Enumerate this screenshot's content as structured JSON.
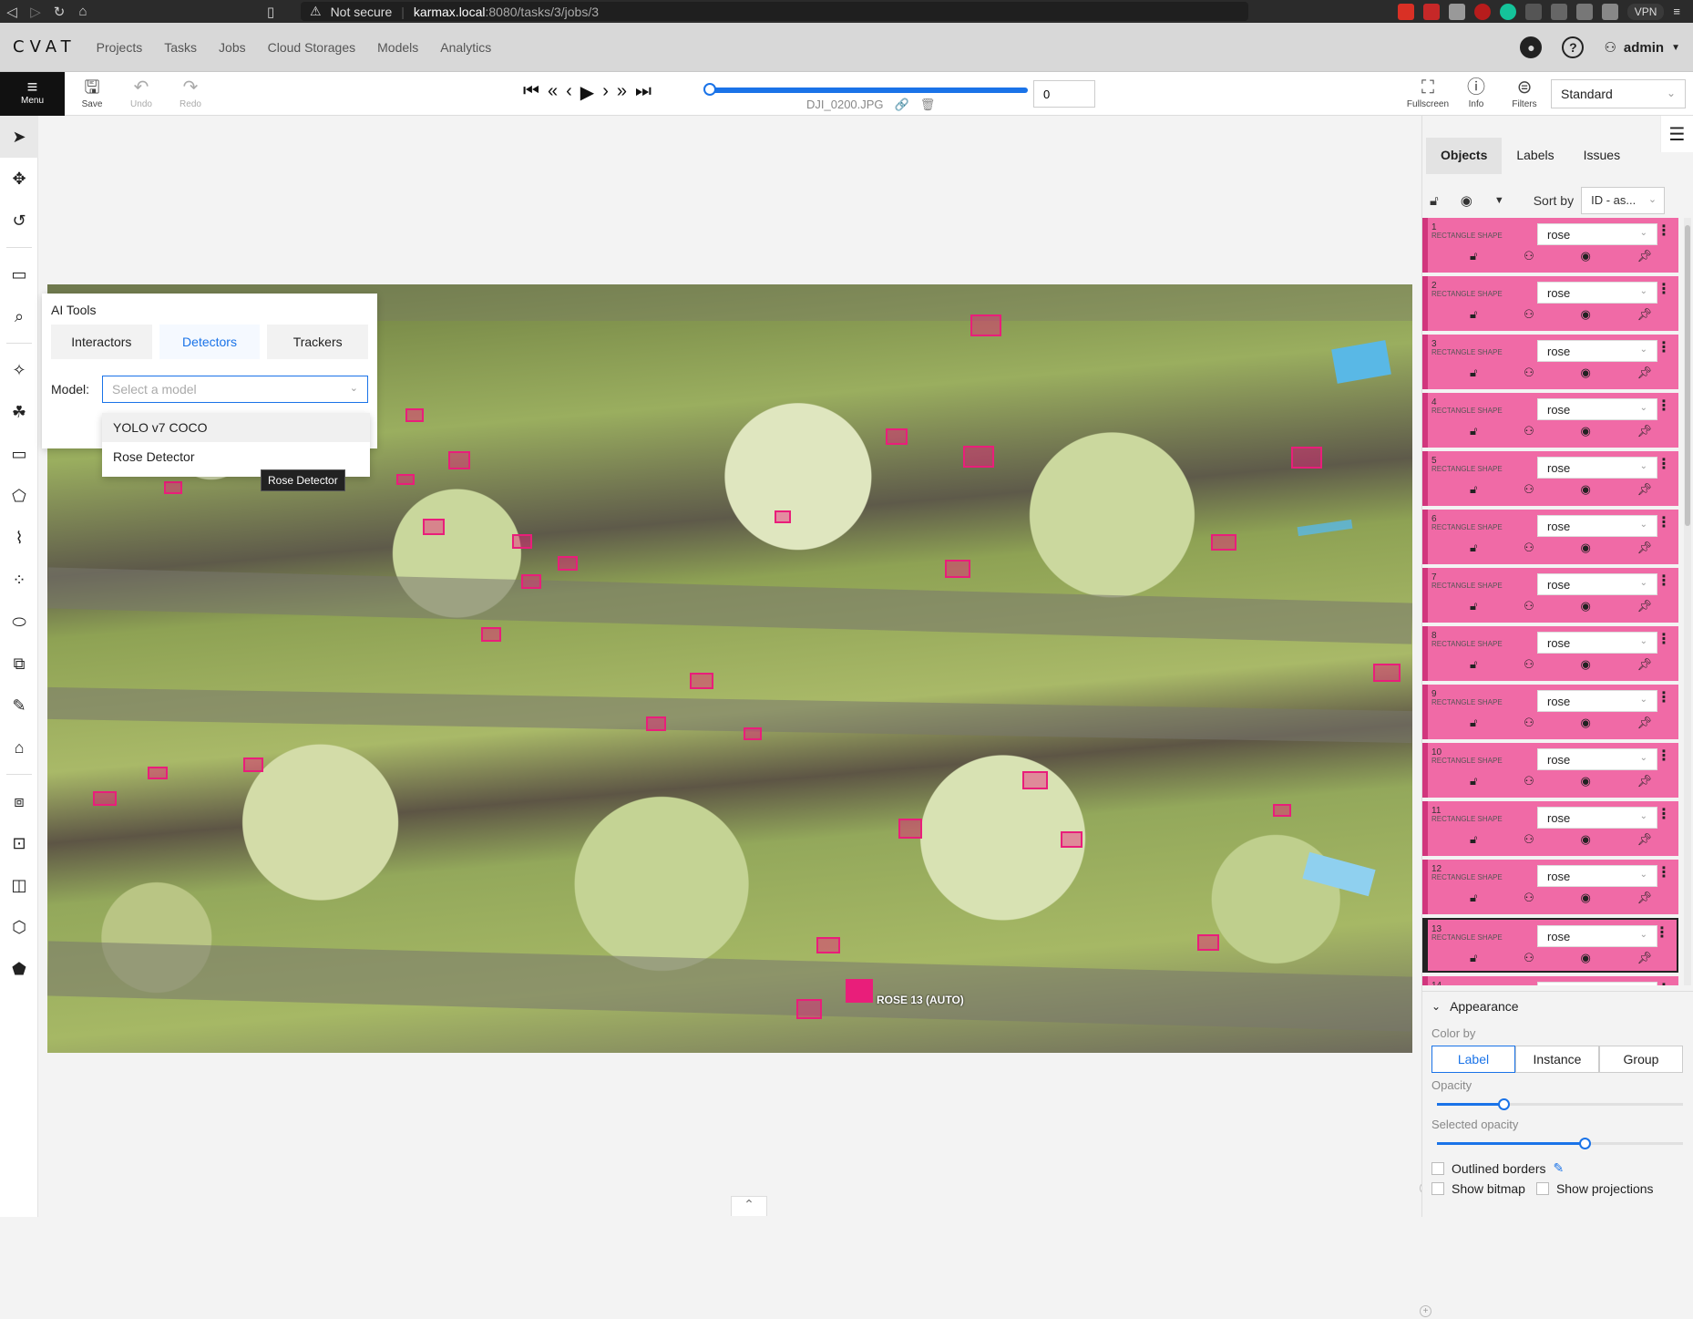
{
  "browser": {
    "security": "Not secure",
    "host": "karmax.local",
    "path": ":8080/tasks/3/jobs/3",
    "vpn": "VPN"
  },
  "header": {
    "logo": "CVAT",
    "nav": [
      "Projects",
      "Tasks",
      "Jobs",
      "Cloud Storages",
      "Models",
      "Analytics"
    ],
    "user": "admin"
  },
  "toolbar": {
    "menu_label": "Menu",
    "save_label": "Save",
    "undo_label": "Undo",
    "redo_label": "Redo",
    "filename": "DJI_0200.JPG",
    "frame": "0",
    "frame_progress": 0,
    "fullscreen_label": "Fullscreen",
    "info_label": "Info",
    "filters_label": "Filters",
    "workspace": "Standard"
  },
  "ai_tools": {
    "title": "AI Tools",
    "tabs": [
      "Interactors",
      "Detectors",
      "Trackers"
    ],
    "active_tab": "Detectors",
    "model_label": "Model:",
    "model_placeholder": "Select a model",
    "options": [
      "YOLO v7 COCO",
      "Rose Detector"
    ],
    "tooltip": "Rose Detector"
  },
  "canvas": {
    "selected_label": "ROSE 13 (AUTO)"
  },
  "right_panel": {
    "tabs": [
      "Objects",
      "Labels",
      "Issues"
    ],
    "active_tab": "Objects",
    "sort_label": "Sort by",
    "sort_value": "ID - as...",
    "objects": [
      {
        "id": "1",
        "type": "RECTANGLE SHAPE",
        "label": "rose"
      },
      {
        "id": "2",
        "type": "RECTANGLE SHAPE",
        "label": "rose"
      },
      {
        "id": "3",
        "type": "RECTANGLE SHAPE",
        "label": "rose"
      },
      {
        "id": "4",
        "type": "RECTANGLE SHAPE",
        "label": "rose"
      },
      {
        "id": "5",
        "type": "RECTANGLE SHAPE",
        "label": "rose"
      },
      {
        "id": "6",
        "type": "RECTANGLE SHAPE",
        "label": "rose"
      },
      {
        "id": "7",
        "type": "RECTANGLE SHAPE",
        "label": "rose"
      },
      {
        "id": "8",
        "type": "RECTANGLE SHAPE",
        "label": "rose"
      },
      {
        "id": "9",
        "type": "RECTANGLE SHAPE",
        "label": "rose"
      },
      {
        "id": "10",
        "type": "RECTANGLE SHAPE",
        "label": "rose"
      },
      {
        "id": "11",
        "type": "RECTANGLE SHAPE",
        "label": "rose"
      },
      {
        "id": "12",
        "type": "RECTANGLE SHAPE",
        "label": "rose"
      },
      {
        "id": "13",
        "type": "RECTANGLE SHAPE",
        "label": "rose"
      },
      {
        "id": "14",
        "type": "",
        "label": ""
      }
    ],
    "appearance": {
      "title": "Appearance",
      "color_by_label": "Color by",
      "color_by_options": [
        "Label",
        "Instance",
        "Group"
      ],
      "color_by_active": "Label",
      "opacity_label": "Opacity",
      "opacity_value": 0.27,
      "selected_opacity_label": "Selected opacity",
      "selected_opacity_value": 0.6,
      "outlined_borders": "Outlined borders",
      "show_bitmap": "Show bitmap",
      "show_projections": "Show projections"
    }
  },
  "colors": {
    "accent": "#1a73e8",
    "label_rose": "#f06aa6",
    "box_fill": "#e91e7a"
  }
}
